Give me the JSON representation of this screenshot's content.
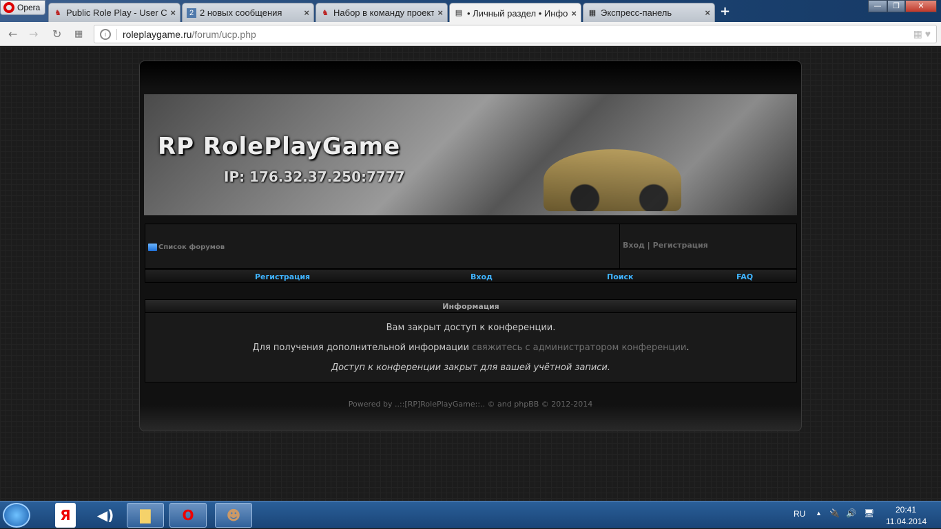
{
  "browser": {
    "menu_label": "Opera",
    "tabs": [
      {
        "title": "Public Role Play - User Cor",
        "icon": "bull-icon"
      },
      {
        "title": "2 новых сообщения",
        "icon": "vk-icon"
      },
      {
        "title": "Набор в команду проекта",
        "icon": "bull-icon"
      },
      {
        "title": "• Личный раздел • Инфор",
        "icon": "page-icon",
        "active": true
      },
      {
        "title": "Экспресс-панель",
        "icon": "grid-icon"
      }
    ],
    "address_host": "roleplaygame.ru",
    "address_path": "/forum/ucp.php"
  },
  "banner": {
    "title": "RP RolePlayGame",
    "ip": "IP: 176.32.37.250:7777"
  },
  "nav": {
    "forum_list": "Список форумов",
    "login": "Вход",
    "separator": "|",
    "register": "Регистрация"
  },
  "menu": {
    "register": "Регистрация",
    "login": "Вход",
    "search": "Поиск",
    "faq": "FAQ"
  },
  "info": {
    "title": "Информация",
    "line1": "Вам закрыт доступ к конференции.",
    "line2_prefix": "Для получения дополнительной информации ",
    "line2_link": "свяжитесь с администратором конференции",
    "line2_suffix": ".",
    "line3": "Доступ к конференции закрыт для вашей учётной записи."
  },
  "footer": {
    "powered": "Powered by ..::[RP]RolePlayGame::.. © and phpBB © 2012-2014"
  },
  "taskbar": {
    "lang": "RU",
    "time": "20:41",
    "date": "11.04.2014"
  }
}
